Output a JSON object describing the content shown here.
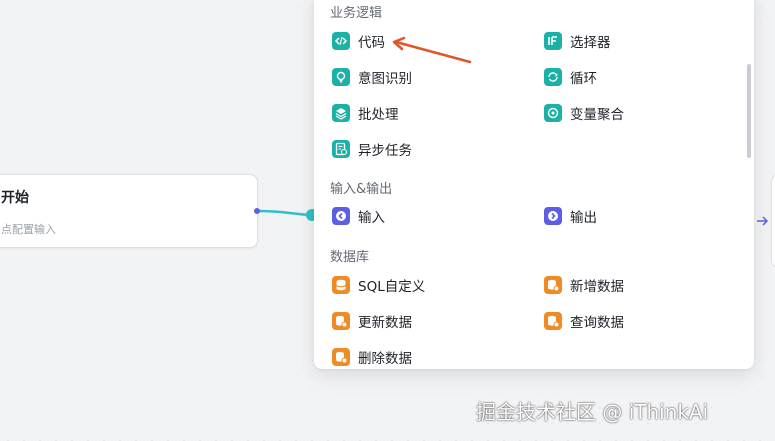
{
  "start_node": {
    "title": "开始",
    "subtitle": "点配置输入"
  },
  "panel": {
    "sections": {
      "business_logic": {
        "title": "业务逻辑",
        "items": {
          "code": "代码",
          "selector": "选择器",
          "intent": "意图识别",
          "loop": "循环",
          "batch": "批处理",
          "var_agg": "变量聚合",
          "async_task": "异步任务"
        }
      },
      "io": {
        "title": "输入&输出",
        "items": {
          "input": "输入",
          "output": "输出"
        }
      },
      "database": {
        "title": "数据库",
        "items": {
          "sql": "SQL自定义",
          "insert": "新增数据",
          "update": "更新数据",
          "query": "查询数据",
          "delete": "删除数据"
        }
      }
    }
  },
  "icons": {
    "code": "code-brackets-icon",
    "selector": "if-icon",
    "intent": "bulb-icon",
    "loop": "loop-icon",
    "batch": "layers-icon",
    "var_agg": "merge-icon",
    "async_task": "doc-clock-icon",
    "input": "arrow-left-icon",
    "output": "arrow-right-icon",
    "database": "database-icon"
  },
  "colors": {
    "teal": "#1cb1a6",
    "indigo": "#5b5fe0",
    "orange": "#f08a24",
    "annotation_arrow": "#e0552a"
  },
  "watermark": "掘金技术社区 @ iThinkAi"
}
